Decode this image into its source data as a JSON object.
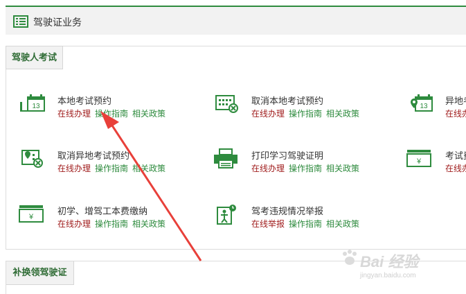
{
  "header": {
    "title": "驾驶证业务",
    "icon": "list-icon"
  },
  "section1": {
    "tab_label": "驾驶人考试"
  },
  "section2": {
    "tab_label": "补换领驾驶证"
  },
  "services": [
    {
      "name": "本地考试预约",
      "icon": "calendar-icon",
      "links": [
        "在线办理",
        "操作指南",
        "相关政策"
      ]
    },
    {
      "name": "取消本地考试预约",
      "icon": "calendar-cancel-icon",
      "links": [
        "在线办理",
        "操作指南",
        "相关政策"
      ]
    },
    {
      "name": "异地考",
      "icon": "calendar-location-icon",
      "links": [
        "在线办"
      ]
    },
    {
      "name": "取消异地考试预约",
      "icon": "calendar-location-cancel-icon",
      "links": [
        "在线办理",
        "操作指南",
        "相关政策"
      ]
    },
    {
      "name": "打印学习驾驶证明",
      "icon": "printer-icon",
      "links": [
        "在线办理",
        "操作指南",
        "相关政策"
      ]
    },
    {
      "name": "考试费",
      "icon": "money-icon",
      "links": [
        "在线办"
      ]
    },
    {
      "name": "初学、增驾工本费缴纳",
      "icon": "money-icon",
      "links": [
        "在线办理",
        "操作指南",
        "相关政策"
      ]
    },
    {
      "name": "驾考违规情况举报",
      "icon": "report-icon",
      "links": [
        "在线举报",
        "操作指南",
        "相关政策"
      ]
    }
  ],
  "watermark": {
    "text": "Bai 经验",
    "sub": "jingyan.baidu.com"
  },
  "colors": {
    "accent": "#2e8b3e",
    "online": "#a01d1d",
    "arrow": "#e8403a"
  }
}
